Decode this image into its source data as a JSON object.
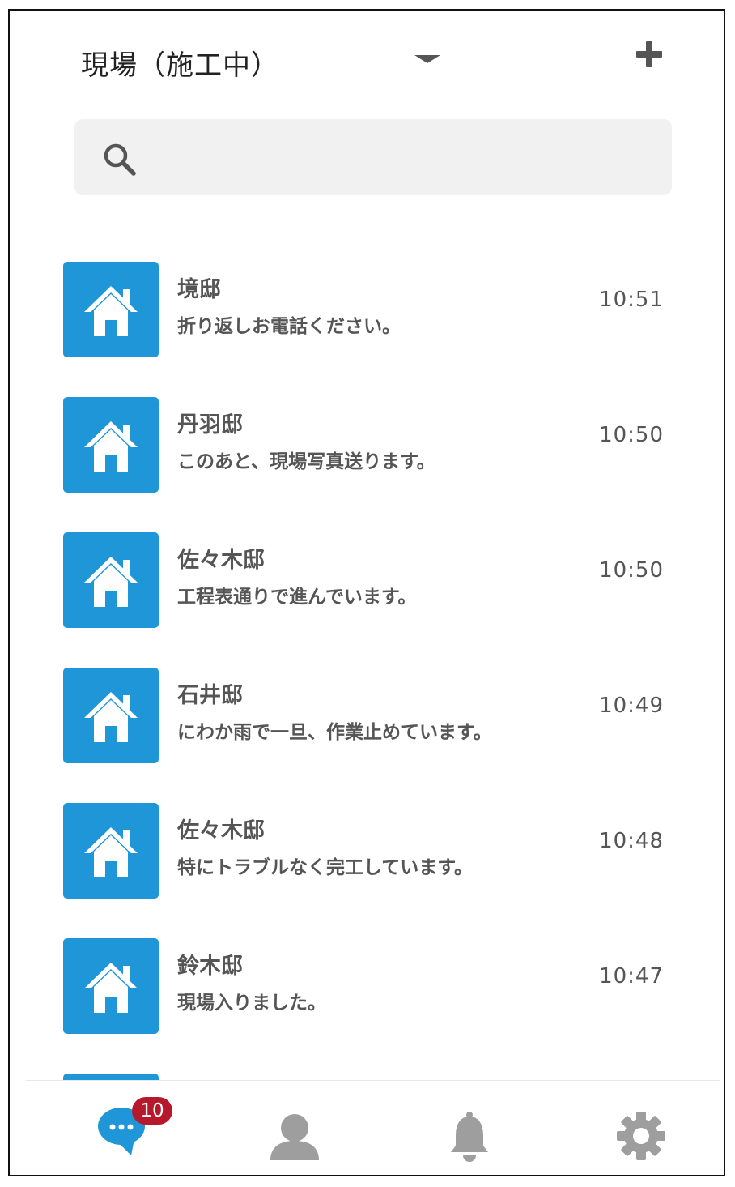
{
  "header": {
    "title": "現場（施工中）",
    "dropdown_icon": "caret-down-icon",
    "add_icon": "plus-icon"
  },
  "search": {
    "icon": "search-icon",
    "placeholder": "",
    "value": ""
  },
  "rooms": [
    {
      "name": "境邸",
      "message": "折り返しお電話ください。",
      "time": "10:51",
      "icon": "house-icon"
    },
    {
      "name": "丹羽邸",
      "message": "このあと、現場写真送ります。",
      "time": "10:50",
      "icon": "house-icon"
    },
    {
      "name": "佐々木邸",
      "message": "工程表通りで進んでいます。",
      "time": "10:50",
      "icon": "house-icon"
    },
    {
      "name": "石井邸",
      "message": "にわか雨で一旦、作業止めています。",
      "time": "10:49",
      "icon": "house-icon"
    },
    {
      "name": "佐々木邸",
      "message": "特にトラブルなく完工しています。",
      "time": "10:48",
      "icon": "house-icon"
    },
    {
      "name": "鈴木邸",
      "message": "現場入りました。",
      "time": "10:47",
      "icon": "house-icon"
    }
  ],
  "tabbar": {
    "tabs": [
      {
        "name": "chat",
        "icon": "chat-bubble-icon",
        "active": true
      },
      {
        "name": "contacts",
        "icon": "person-icon",
        "active": false
      },
      {
        "name": "notifications",
        "icon": "bell-icon",
        "active": false
      },
      {
        "name": "settings",
        "icon": "gear-icon",
        "active": false
      }
    ],
    "chat_badge": "10"
  },
  "colors": {
    "accent": "#1e96d8",
    "badge": "#b5192b",
    "inactive_icon": "#9e9e9e",
    "text": "#555555"
  }
}
